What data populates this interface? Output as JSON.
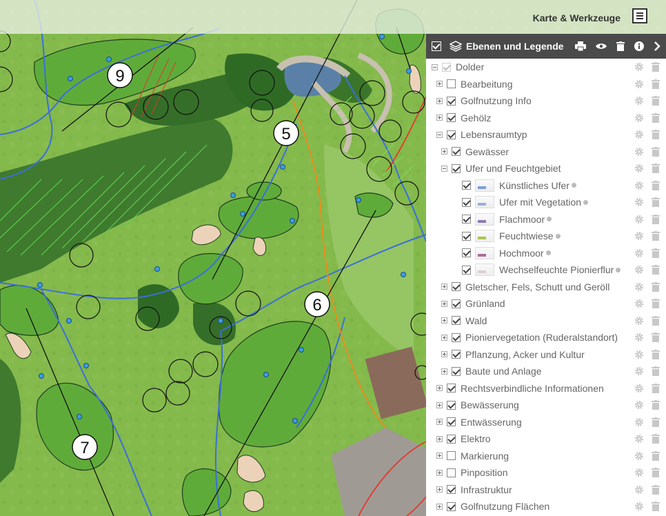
{
  "toolbar": {
    "title": "Karte & Werkzeuge",
    "menu_icon": "hamburger-menu-icon"
  },
  "map": {
    "hole_labels": [
      "9",
      "5",
      "6",
      "7"
    ]
  },
  "panel": {
    "title": "Ebenen und Legende",
    "header_icons": [
      "layers-icon",
      "print-icon",
      "eye-icon",
      "trash-icon",
      "info-icon",
      "chevron-right-icon"
    ],
    "rows": [
      {
        "label": "Dolder",
        "level": 0,
        "expander": "minus",
        "checked": true,
        "dim": true
      },
      {
        "label": "Bearbeitung",
        "level": 1,
        "expander": "plus",
        "checked": false
      },
      {
        "label": "Golfnutzung Info",
        "level": 1,
        "expander": "plus",
        "checked": true
      },
      {
        "label": "Gehölz",
        "level": 1,
        "expander": "plus",
        "checked": true
      },
      {
        "label": "Lebensraumtyp",
        "level": 1,
        "expander": "minus",
        "checked": true
      },
      {
        "label": "Gewässer",
        "level": 2,
        "expander": "plus",
        "checked": true
      },
      {
        "label": "Ufer und Feuchtgebiet",
        "level": 2,
        "expander": "minus",
        "checked": true
      },
      {
        "label": "Künstliches Ufer",
        "level": 3,
        "checked": true,
        "legend": true,
        "swatch": "#7aa0d8"
      },
      {
        "label": "Ufer mit Vegetation",
        "level": 3,
        "checked": true,
        "legend": true,
        "swatch": "#9ab0d8"
      },
      {
        "label": "Flachmoor",
        "level": 3,
        "checked": true,
        "legend": true,
        "swatch": "#8a7ab8"
      },
      {
        "label": "Feuchtwiese",
        "level": 3,
        "checked": true,
        "legend": true,
        "swatch": "#a8c84a"
      },
      {
        "label": "Hochmoor",
        "level": 3,
        "checked": true,
        "legend": true,
        "swatch": "#b06aa0"
      },
      {
        "label": "Wechselfeuchte Pionierflur",
        "level": 3,
        "checked": true,
        "legend": true,
        "swatch": "#e0d0d0"
      },
      {
        "label": "Gletscher, Fels, Schutt und Geröll",
        "level": 2,
        "expander": "plus",
        "checked": true
      },
      {
        "label": "Grünland",
        "level": 2,
        "expander": "plus",
        "checked": true
      },
      {
        "label": "Wald",
        "level": 2,
        "expander": "plus",
        "checked": true
      },
      {
        "label": "Pioniervegetation (Ruderalstandort)",
        "level": 2,
        "expander": "plus",
        "checked": true
      },
      {
        "label": "Pflanzung, Acker und Kultur",
        "level": 2,
        "expander": "plus",
        "checked": true
      },
      {
        "label": "Baute und Anlage",
        "level": 2,
        "expander": "plus",
        "checked": true
      },
      {
        "label": "Rechtsverbindliche Informationen",
        "level": 1,
        "expander": "plus",
        "checked": true
      },
      {
        "label": "Bewässerung",
        "level": 1,
        "expander": "plus",
        "checked": true
      },
      {
        "label": "Entwässerung",
        "level": 1,
        "expander": "plus",
        "checked": true
      },
      {
        "label": "Elektro",
        "level": 1,
        "expander": "plus",
        "checked": true
      },
      {
        "label": "Markierung",
        "level": 1,
        "expander": "plus",
        "checked": false
      },
      {
        "label": "Pinposition",
        "level": 1,
        "expander": "plus",
        "checked": false
      },
      {
        "label": "Infrastruktur",
        "level": 1,
        "expander": "plus",
        "checked": true
      },
      {
        "label": "Golfnutzung Flächen",
        "level": 1,
        "expander": "plus",
        "checked": true
      }
    ]
  }
}
